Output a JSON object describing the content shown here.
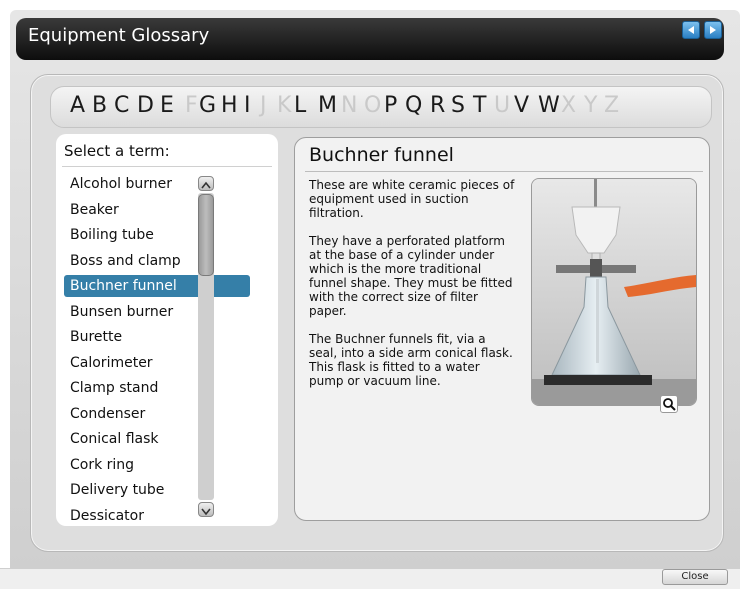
{
  "window": {
    "title": "Equipment Glossary"
  },
  "nav": {
    "prev_icon": "triangle-left-icon",
    "next_icon": "triangle-right-icon",
    "accent": "#3a8fd6"
  },
  "alphabet": [
    {
      "l": "A",
      "on": true
    },
    {
      "l": "B",
      "on": true
    },
    {
      "l": "C",
      "on": true
    },
    {
      "l": "D",
      "on": true
    },
    {
      "l": "E",
      "on": true
    },
    {
      "l": "F",
      "on": false
    },
    {
      "l": "G",
      "on": true
    },
    {
      "l": "H",
      "on": true
    },
    {
      "l": "I",
      "on": true
    },
    {
      "l": "J",
      "on": false
    },
    {
      "l": "K",
      "on": false
    },
    {
      "l": "L",
      "on": true
    },
    {
      "l": "M",
      "on": true
    },
    {
      "l": "N",
      "on": false
    },
    {
      "l": "O",
      "on": false
    },
    {
      "l": "P",
      "on": true
    },
    {
      "l": "Q",
      "on": true
    },
    {
      "l": "R",
      "on": true
    },
    {
      "l": "S",
      "on": true
    },
    {
      "l": "T",
      "on": true
    },
    {
      "l": "U",
      "on": false
    },
    {
      "l": "V",
      "on": true
    },
    {
      "l": "W",
      "on": true
    },
    {
      "l": "X",
      "on": false
    },
    {
      "l": "Y",
      "on": false
    },
    {
      "l": "Z",
      "on": false
    }
  ],
  "term_list": {
    "header": "Select a term:",
    "items": [
      "Alcohol burner",
      "Beaker",
      "Boiling tube",
      "Boss and clamp",
      "Buchner funnel",
      "Bunsen burner",
      "Burette",
      "Calorimeter",
      "Clamp stand",
      "Condenser",
      "Conical flask",
      "Cork ring",
      "Delivery tube",
      "Dessicator"
    ],
    "selected": "Buchner funnel",
    "selected_color": "#357fa8"
  },
  "detail": {
    "title": "Buchner funnel",
    "paragraphs": [
      "These are white ceramic pieces of equipment used in suction filtration.",
      "They have a perforated platform at the base of a cylinder under which is the more traditional funnel shape. They must be fitted with the correct size of filter paper.",
      "The Buchner funnels fit, via a seal, into a side arm conical flask. This flask is fitted to a water pump or vacuum line."
    ],
    "zoom_icon": "magnifier-icon"
  },
  "footer": {
    "close_label": "Close"
  }
}
